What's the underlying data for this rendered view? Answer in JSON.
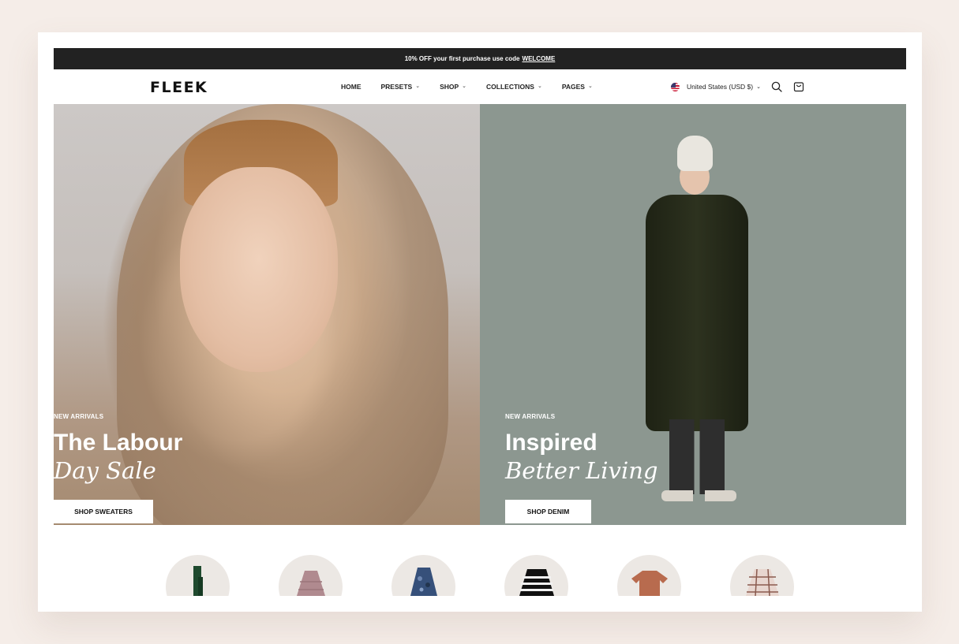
{
  "announcement": {
    "text": "10% OFF your first purchase use code",
    "code": "WELCOME"
  },
  "header": {
    "logo": "FLEEK",
    "nav": [
      {
        "label": "HOME",
        "has_dropdown": false
      },
      {
        "label": "PRESETS",
        "has_dropdown": true
      },
      {
        "label": "SHOP",
        "has_dropdown": true
      },
      {
        "label": "COLLECTIONS",
        "has_dropdown": true
      },
      {
        "label": "PAGES",
        "has_dropdown": true
      }
    ],
    "currency": "United States (USD $)",
    "icons": [
      "us-flag-icon",
      "search-icon",
      "cart-icon"
    ]
  },
  "hero": {
    "left": {
      "eyebrow": "NEW ARRIVALS",
      "title": "The Labour",
      "subtitle": "Day Sale",
      "button": "SHOP SWEATERS"
    },
    "right": {
      "eyebrow": "NEW ARRIVALS",
      "title": "Inspired",
      "subtitle": "Better Living",
      "button": "SHOP DENIM"
    }
  },
  "categories": [
    {
      "icon": "green-scarf-icon",
      "color": "#1f4a2e"
    },
    {
      "icon": "pink-puffer-jacket-icon",
      "color": "#b08a8f"
    },
    {
      "icon": "blue-patterned-jacket-icon",
      "color": "#36507a"
    },
    {
      "icon": "striped-sweater-icon",
      "color": "#111111"
    },
    {
      "icon": "rust-tshirt-icon",
      "color": "#b86b4e"
    },
    {
      "icon": "plaid-shirt-icon",
      "color": "#c9a89e"
    }
  ],
  "colors": {
    "page_background": "#f5ede8",
    "announcement_bar": "#222222",
    "right_panel": "#8c9790"
  }
}
